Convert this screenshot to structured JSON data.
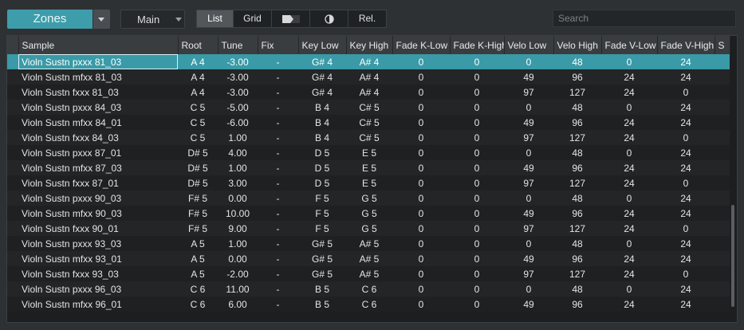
{
  "toolbar": {
    "zones_label": "Zones",
    "main_label": "Main",
    "buttons": {
      "list": "List",
      "grid": "Grid",
      "rel": "Rel."
    },
    "search_placeholder": "Search"
  },
  "table": {
    "headers": [
      "Sample",
      "Root",
      "Tune",
      "Fix",
      "Key Low",
      "Key High",
      "Fade K-Low",
      "Fade K-High",
      "Velo Low",
      "Velo High",
      "Fade V-Low",
      "Fade V-High",
      "S"
    ],
    "rows": [
      [
        "Violn Sustn pxxx 81_03",
        "A 4",
        "-3.00",
        "-",
        "G# 4",
        "A# 4",
        "0",
        "0",
        "0",
        "48",
        "0",
        "24"
      ],
      [
        "Violn Sustn mfxx 81_03",
        "A 4",
        "-3.00",
        "-",
        "G# 4",
        "A# 4",
        "0",
        "0",
        "49",
        "96",
        "24",
        "24"
      ],
      [
        "Violn Sustn fxxx 81_03",
        "A 4",
        "-3.00",
        "-",
        "G# 4",
        "A# 4",
        "0",
        "0",
        "97",
        "127",
        "24",
        "0"
      ],
      [
        "Violn Sustn pxxx 84_03",
        "C 5",
        "-5.00",
        "-",
        "B 4",
        "C# 5",
        "0",
        "0",
        "0",
        "48",
        "0",
        "24"
      ],
      [
        "Violn Sustn mfxx 84_01",
        "C 5",
        "-6.00",
        "-",
        "B 4",
        "C# 5",
        "0",
        "0",
        "49",
        "96",
        "24",
        "24"
      ],
      [
        "Violn Sustn fxxx 84_03",
        "C 5",
        "1.00",
        "-",
        "B 4",
        "C# 5",
        "0",
        "0",
        "97",
        "127",
        "24",
        "0"
      ],
      [
        "Violn Sustn pxxx 87_01",
        "D# 5",
        "4.00",
        "-",
        "D 5",
        "E 5",
        "0",
        "0",
        "0",
        "48",
        "0",
        "24"
      ],
      [
        "Violn Sustn mfxx 87_03",
        "D# 5",
        "1.00",
        "-",
        "D 5",
        "E 5",
        "0",
        "0",
        "49",
        "96",
        "24",
        "24"
      ],
      [
        "Violn Sustn fxxx 87_01",
        "D# 5",
        "3.00",
        "-",
        "D 5",
        "E 5",
        "0",
        "0",
        "97",
        "127",
        "24",
        "0"
      ],
      [
        "Violn Sustn pxxx 90_03",
        "F# 5",
        "0.00",
        "-",
        "F 5",
        "G 5",
        "0",
        "0",
        "0",
        "48",
        "0",
        "24"
      ],
      [
        "Violn Sustn mfxx 90_03",
        "F# 5",
        "10.00",
        "-",
        "F 5",
        "G 5",
        "0",
        "0",
        "49",
        "96",
        "24",
        "24"
      ],
      [
        "Violn Sustn fxxx 90_01",
        "F# 5",
        "9.00",
        "-",
        "F 5",
        "G 5",
        "0",
        "0",
        "97",
        "127",
        "24",
        "0"
      ],
      [
        "Violn Sustn pxxx 93_03",
        "A 5",
        "1.00",
        "-",
        "G# 5",
        "A# 5",
        "0",
        "0",
        "0",
        "48",
        "0",
        "24"
      ],
      [
        "Violn Sustn mfxx 93_01",
        "A 5",
        "0.00",
        "-",
        "G# 5",
        "A# 5",
        "0",
        "0",
        "49",
        "96",
        "24",
        "24"
      ],
      [
        "Violn Sustn fxxx 93_03",
        "A 5",
        "-2.00",
        "-",
        "G# 5",
        "A# 5",
        "0",
        "0",
        "97",
        "127",
        "24",
        "0"
      ],
      [
        "Violn Sustn pxxx 96_03",
        "C 6",
        "11.00",
        "-",
        "B 5",
        "C 6",
        "0",
        "0",
        "0",
        "48",
        "0",
        "24"
      ],
      [
        "Violn Sustn mfxx 96_01",
        "C 6",
        "6.00",
        "-",
        "B 5",
        "C 6",
        "0",
        "0",
        "49",
        "96",
        "24",
        "24"
      ]
    ],
    "selected_row": 0
  },
  "colors": {
    "accent": "#3e9dab",
    "selected_row": "#3a9aa7"
  }
}
